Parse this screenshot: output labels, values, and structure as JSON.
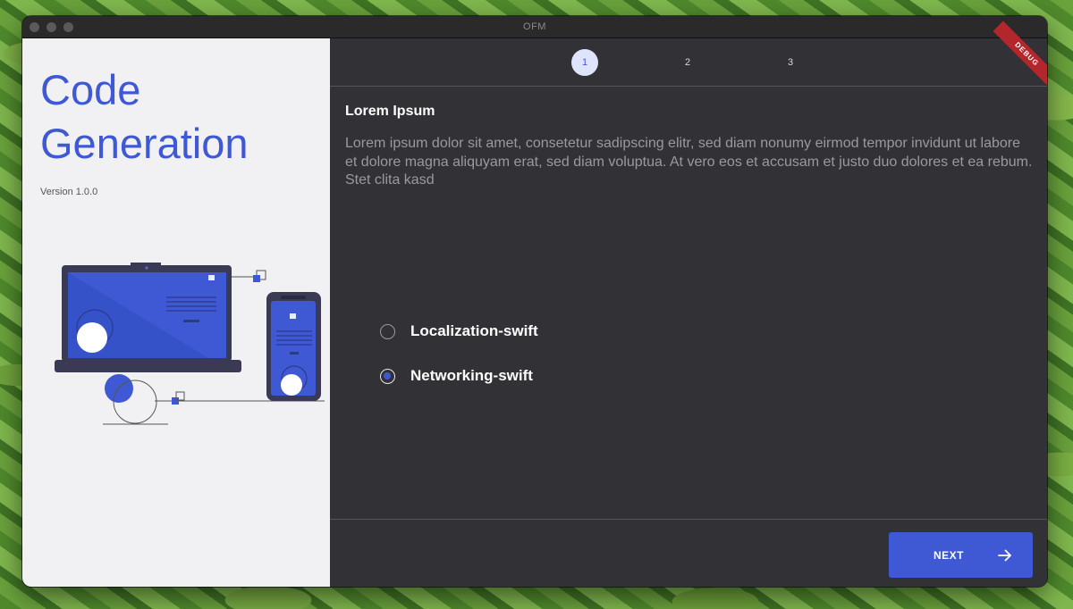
{
  "window": {
    "title": "OFM"
  },
  "sidebar": {
    "title": "Code Generation",
    "version": "Version 1.0.0"
  },
  "stepper": {
    "steps": [
      "1",
      "2",
      "3"
    ],
    "active_step": 1
  },
  "debug_banner": "DEBUG",
  "main": {
    "heading": "Lorem Ipsum",
    "body": "Lorem ipsum dolor sit amet, consetetur sadipscing elitr, sed diam nonumy eirmod tempor invidunt ut labore et dolore magna aliquyam erat, sed diam voluptua. At vero eos et accusam et justo duo dolores et ea rebum. Stet clita kasd",
    "options": [
      {
        "label": "Localization-swift",
        "selected": false
      },
      {
        "label": "Networking-swift",
        "selected": true
      }
    ]
  },
  "footer": {
    "next_label": "NEXT"
  },
  "colors": {
    "accent": "#3f59d4",
    "panel_dark": "#323136",
    "sidebar_bg": "#f1f1f4",
    "debug_red": "#b3262b"
  },
  "icons": {
    "next": "arrow-right-icon",
    "illustration": "devices-illustration"
  }
}
